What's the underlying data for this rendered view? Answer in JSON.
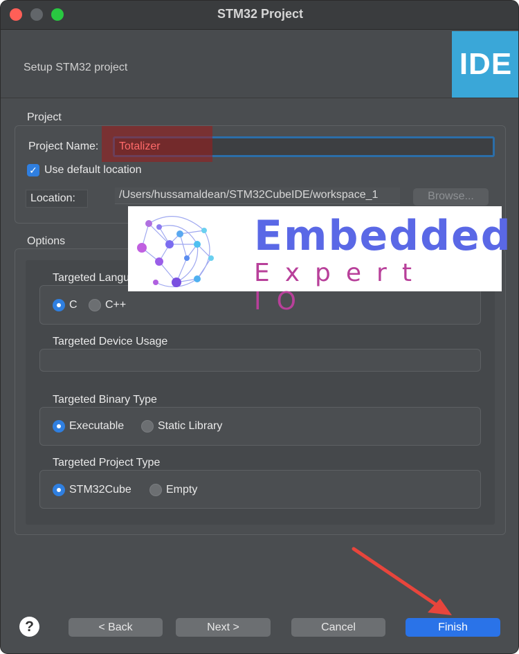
{
  "window": {
    "title": "STM32 Project"
  },
  "header": {
    "subtitle": "Setup STM32 project",
    "logo_text": "IDE"
  },
  "project_group": {
    "label": "Project",
    "name_label": "Project Name:",
    "name_value": "Totalizer",
    "use_default_location_label": "Use default location",
    "use_default_location_checked": true,
    "location_label": "Location:",
    "location_value": "/Users/hussamaldean/STM32CubeIDE/workspace_1",
    "browse_label": "Browse..."
  },
  "options_group": {
    "label": "Options",
    "language": {
      "label": "Targeted Language",
      "options": [
        "C",
        "C++"
      ],
      "selected": "C"
    },
    "device_usage": {
      "label": "Targeted Device Usage"
    },
    "binary_type": {
      "label": "Targeted Binary Type",
      "options": [
        "Executable",
        "Static Library"
      ],
      "selected": "Executable"
    },
    "project_type": {
      "label": "Targeted Project Type",
      "options": [
        "STM32Cube",
        "Empty"
      ],
      "selected": "STM32Cube"
    }
  },
  "watermark": {
    "line1": "Embedded",
    "line2": "Expert IO"
  },
  "footer": {
    "help_label": "?",
    "back_label": "< Back",
    "next_label": "Next >",
    "cancel_label": "Cancel",
    "finish_label": "Finish"
  },
  "colors": {
    "accent": "#2a73e8",
    "annotation_arrow": "#e8453c",
    "highlight": "#a01919",
    "ide_logo": "#3aa7d8"
  }
}
